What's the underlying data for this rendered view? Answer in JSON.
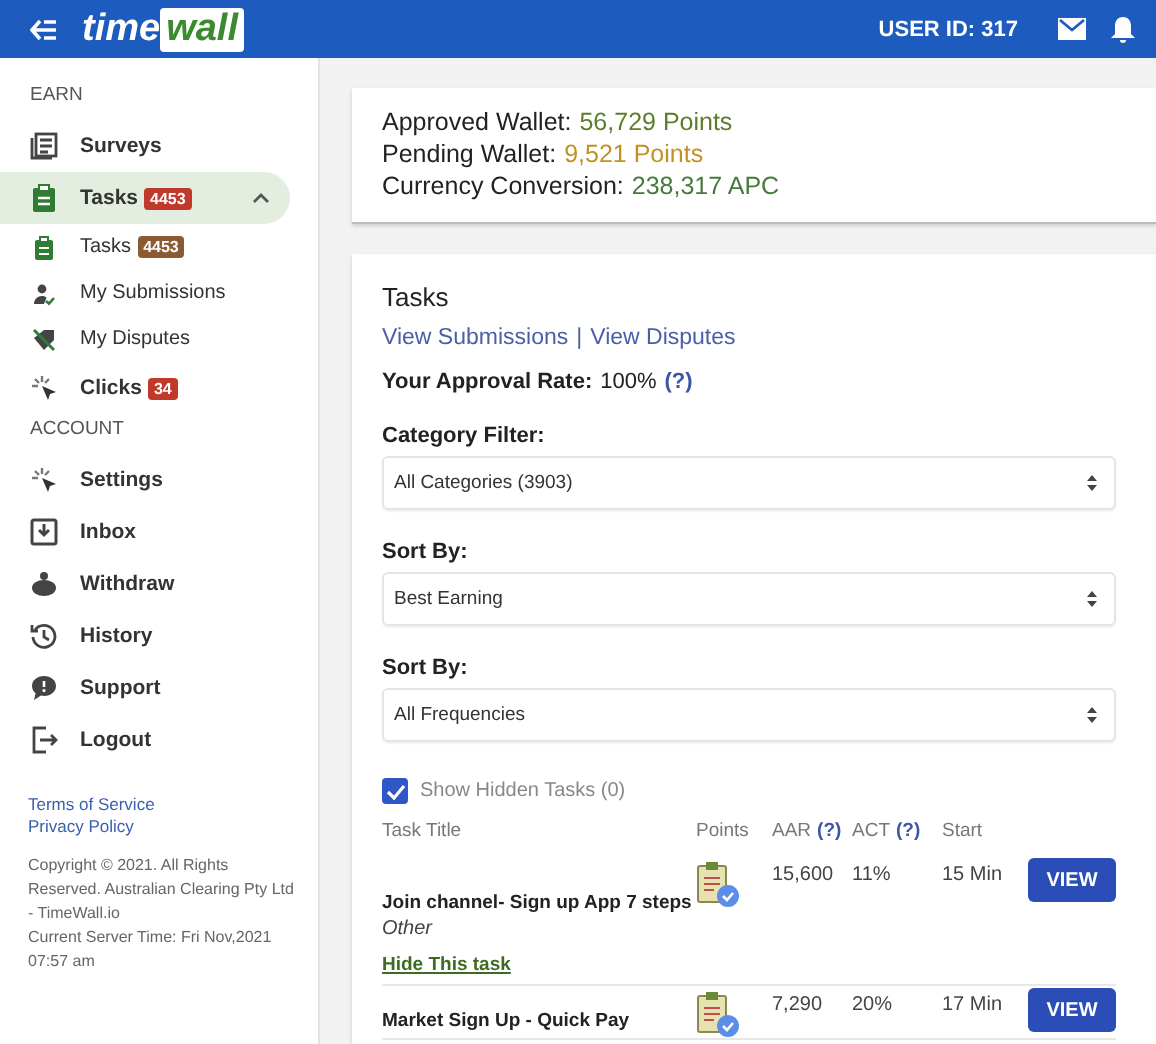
{
  "header": {
    "logo_parts": [
      "time",
      "wall"
    ],
    "user_id": "USER ID: 317"
  },
  "sidebar": {
    "sections": [
      {
        "label": "EARN",
        "items": [
          {
            "label": "Surveys",
            "selected": false
          },
          {
            "label": "Tasks",
            "badge": "4453",
            "color": "#c0392b",
            "selected": true,
            "expanded": true,
            "children": [
              {
                "label": "Tasks",
                "badge": "4453",
                "color": "#8a5a32",
                "selected": false
              },
              {
                "label": "My Submissions",
                "selected": false
              },
              {
                "label": "My Disputes",
                "selected": false
              }
            ]
          },
          {
            "label": "Clicks",
            "badge": "34",
            "color": "#c0392b",
            "selected": false
          }
        ]
      },
      {
        "label": "ACCOUNT",
        "items": [
          {
            "label": "Settings",
            "selected": false
          },
          {
            "label": "Inbox",
            "selected": false
          },
          {
            "label": "Withdraw",
            "selected": false
          },
          {
            "label": "History",
            "selected": false
          },
          {
            "label": "Support",
            "selected": false
          },
          {
            "label": "Logout",
            "selected": false
          }
        ]
      }
    ],
    "links": [
      "Terms of Service",
      "Privacy Policy"
    ],
    "footer": [
      "Copyright © 2021. All Rights Reserved. Australian Clearing Pty Ltd - TimeWall.io",
      "Current Server Time: Fri Nov,2021 07:57 am"
    ]
  },
  "wallet": [
    {
      "label": "Approved Wallet:",
      "value": "56,729 Points",
      "color": "#5b7d2c"
    },
    {
      "label": "Pending Wallet:",
      "value": "9,521 Points",
      "color": "#c39122"
    },
    {
      "label": "Currency Conversion:",
      "value": "238,317 APC",
      "color": "#467a3c"
    }
  ],
  "tasks": {
    "title": "Tasks",
    "links": [
      "View Submissions",
      "View Disputes"
    ],
    "separator": "|",
    "approval": {
      "label": "Your Approval Rate:",
      "value": "100%",
      "help": "(?)"
    },
    "filters": [
      {
        "label": "Category Filter:",
        "value": "All Categories (3903)"
      },
      {
        "label": "Sort By:",
        "value": "Best Earning"
      },
      {
        "label": "Sort By:",
        "value": "All Frequencies"
      }
    ],
    "hidden_toggle": {
      "label": "Show Hidden Tasks (0)",
      "checked": true
    },
    "table": {
      "columns": [
        {
          "label": "Task Title"
        },
        {
          "label": "Points"
        },
        {
          "label": "AAR",
          "help": "(?)"
        },
        {
          "label": "ACT",
          "help": "(?)"
        },
        {
          "label": "Start"
        }
      ],
      "rows": [
        {
          "title": "Join channel- Sign up App 7 steps",
          "category": "Other",
          "hide_link": "Hide This task",
          "points": "15,600",
          "aar": "11%",
          "act": "15 Min",
          "button": "VIEW"
        },
        {
          "title": "Market Sign Up - Quick Pay",
          "points": "7,290",
          "aar": "20%",
          "act": "17 Min",
          "button": "VIEW"
        }
      ]
    }
  }
}
